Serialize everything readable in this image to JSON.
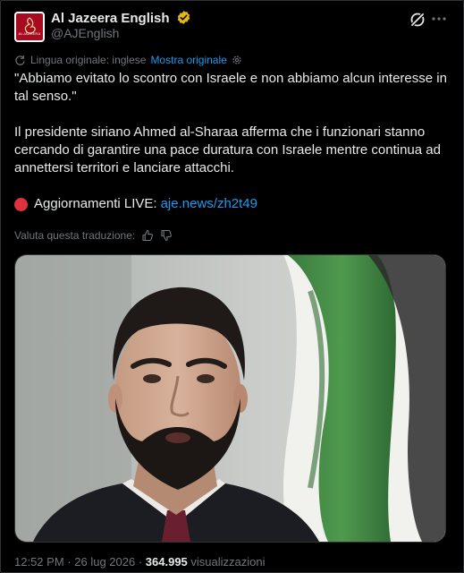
{
  "author": {
    "name": "Al Jazeera English",
    "handle": "@AJEnglish",
    "avatar_text": "ALJAZEERA"
  },
  "translation": {
    "original_language": "Lingua originale: inglese",
    "show_original": "Mostra originale"
  },
  "tweet": {
    "paragraph1": "\"Abbiamo evitato lo scontro con Israele e non abbiamo alcun interesse in tal senso.\"",
    "paragraph2": "Il presidente siriano Ahmed al-Sharaa afferma che i funzionari stanno cercando di garantire una pace duratura con Israele mentre continua ad annettersi territori e lanciare attacchi.",
    "live_label": "Aggiornamenti LIVE:",
    "live_link": "aje.news/zh2t49"
  },
  "rate_translation": "Valuta questa traduzione:",
  "footer": {
    "time": "12:52 PM",
    "date": "26 lug 2026",
    "views_count": "364.995",
    "views_label": "visualizzazioni"
  },
  "colors": {
    "background": "#000000",
    "text": "#e7e9ea",
    "muted": "#71767b",
    "link": "#1d9bf0",
    "verified_badge": "#e2b719",
    "live_dot": "#e0323c"
  },
  "icons": [
    "verified-badge-icon",
    "grok-icon",
    "more-icon",
    "translate-sparkle-icon",
    "settings-icon",
    "thumbs-up-icon",
    "thumbs-down-icon"
  ]
}
